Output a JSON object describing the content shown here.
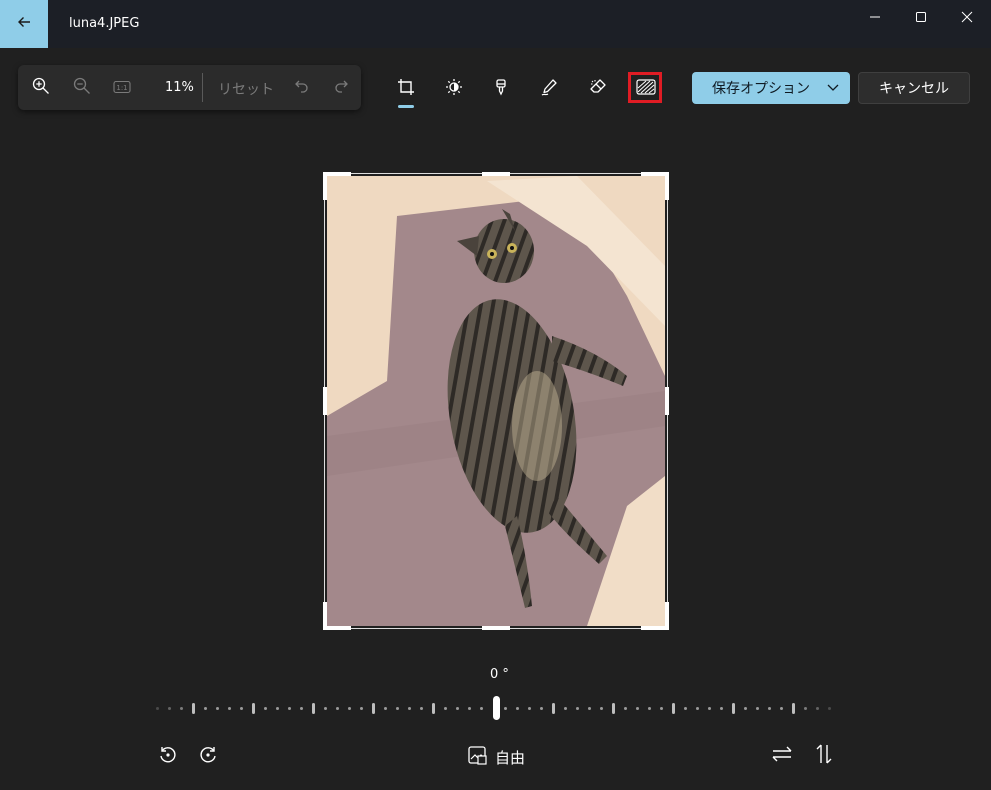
{
  "window": {
    "title": "luna4.JPEG",
    "icons": {
      "back": "back-arrow-icon",
      "minimize": "minimize-icon",
      "maximize": "maximize-icon",
      "close": "close-icon"
    }
  },
  "zoom_toolbar": {
    "zoom_level": "11%",
    "reset_label": "リセット",
    "icons": [
      "zoom-in-icon",
      "zoom-out-icon",
      "actual-size-icon",
      "undo-icon",
      "redo-icon"
    ]
  },
  "edit_tools": [
    {
      "name": "crop",
      "icon": "crop-icon",
      "selected": true
    },
    {
      "name": "adjust",
      "icon": "brightness-icon",
      "selected": false
    },
    {
      "name": "filter",
      "icon": "filter-icon",
      "selected": false
    },
    {
      "name": "markup",
      "icon": "pen-icon",
      "selected": false
    },
    {
      "name": "erase",
      "icon": "eraser-icon",
      "selected": false
    },
    {
      "name": "background",
      "icon": "background-icon",
      "selected": false,
      "highlighted": true
    }
  ],
  "actions": {
    "save_label": "保存オプション",
    "cancel_label": "キャンセル"
  },
  "crop": {
    "angle_label": "0 °",
    "aspect_label": "自由",
    "rotation_degrees": 0
  },
  "colors": {
    "accent": "#8fcde8",
    "highlight": "#e01c24",
    "background": "#202020"
  }
}
